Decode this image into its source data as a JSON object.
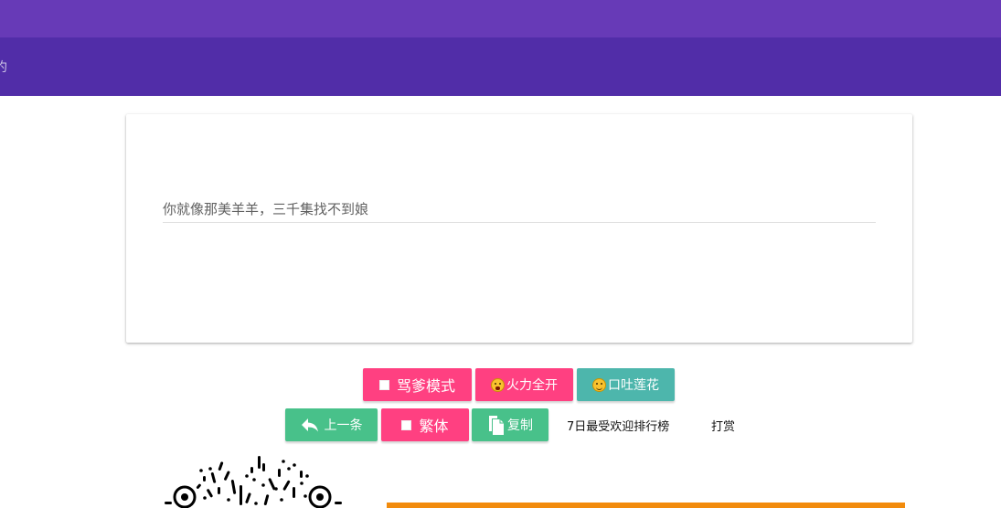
{
  "header": {
    "subtitle_fragment": "约"
  },
  "quote": {
    "text": "你就像那美羊羊，三千集找不到娘"
  },
  "buttons": {
    "row1": {
      "mode_label": "骂爹模式",
      "fire_label": "火力全开",
      "lotus_label": "口吐莲花"
    },
    "row2": {
      "prev_label": "上一条",
      "trad_label": "繁体",
      "copy_label": "复制",
      "ranking_label": "7日最受欢迎排行榜",
      "reward_label": "打赏"
    }
  },
  "colors": {
    "topbar": "#673ab7",
    "subbar": "#512da8",
    "pink": "#ff4081",
    "teal": "#4db6ac",
    "green": "#48c18a",
    "orange": "#f28b0c"
  },
  "icons": {
    "checkbox": "checkbox-icon",
    "fire_emoji": "screaming-face-icon",
    "smile_emoji": "smile-face-icon",
    "back_arrow": "reply-arrow-icon",
    "copy": "copy-icon",
    "qr": "qr-code-icon"
  }
}
